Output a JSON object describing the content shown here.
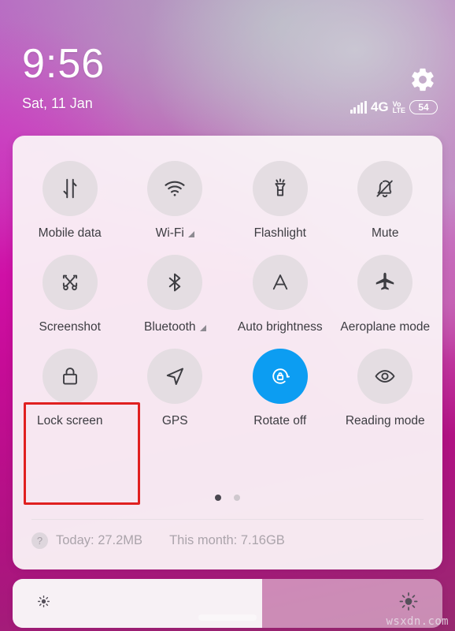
{
  "status": {
    "clock": "9:56",
    "date": "Sat, 11 Jan",
    "network": "4G",
    "volte_top": "Vo",
    "volte_bottom": "LTE",
    "battery": "54",
    "gear_icon": "gear-icon",
    "signal_icon": "signal-bars-icon"
  },
  "quick_settings": {
    "tiles": [
      {
        "label": "Mobile data",
        "icon": "mobile-data-icon",
        "active": false,
        "expandable": false
      },
      {
        "label": "Wi-Fi",
        "icon": "wifi-icon",
        "active": false,
        "expandable": true
      },
      {
        "label": "Flashlight",
        "icon": "flashlight-icon",
        "active": false,
        "expandable": false
      },
      {
        "label": "Mute",
        "icon": "bell-muted-icon",
        "active": false,
        "expandable": false
      },
      {
        "label": "Screenshot",
        "icon": "screenshot-icon",
        "active": false,
        "expandable": false
      },
      {
        "label": "Bluetooth",
        "icon": "bluetooth-icon",
        "active": false,
        "expandable": true
      },
      {
        "label": "Auto brightness",
        "icon": "auto-brightness-icon",
        "active": false,
        "expandable": false
      },
      {
        "label": "Aeroplane mode",
        "icon": "airplane-icon",
        "active": false,
        "expandable": false
      },
      {
        "label": "Lock screen",
        "icon": "lock-icon",
        "active": false,
        "expandable": false
      },
      {
        "label": "GPS",
        "icon": "gps-arrow-icon",
        "active": false,
        "expandable": false
      },
      {
        "label": "Rotate off",
        "icon": "rotation-lock-icon",
        "active": true,
        "expandable": false
      },
      {
        "label": "Reading mode",
        "icon": "eye-icon",
        "active": false,
        "expandable": false
      }
    ],
    "pages": {
      "count": 2,
      "active_index": 0
    },
    "data_usage": {
      "help_icon": "question-mark-icon",
      "today": "Today: 27.2MB",
      "month": "This month: 7.16GB"
    }
  },
  "highlight": {
    "target": "Screenshot",
    "color": "#e02020"
  },
  "brightness": {
    "value_percent": 58,
    "low_icon": "sun-small-icon",
    "high_icon": "sun-large-icon"
  },
  "watermark": "wsxdn.com",
  "colors": {
    "active_tile": "#0c9df2",
    "panel_bg": "#faf3f7",
    "tile_circle": "#e4dde2",
    "highlight": "#e02020"
  }
}
